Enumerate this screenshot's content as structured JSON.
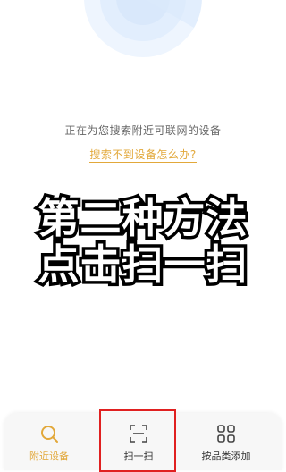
{
  "search": {
    "status_text": "正在为您搜索附近可联网的设备",
    "help_link": "搜索不到设备怎么办?"
  },
  "overlay": {
    "line1": "第二种方法",
    "line2": "点击扫一扫"
  },
  "tabs": [
    {
      "label": "附近设备",
      "icon": "search-icon",
      "active": true
    },
    {
      "label": "扫一扫",
      "icon": "scan-icon",
      "active": false
    },
    {
      "label": "按品类添加",
      "icon": "grid-icon",
      "active": false
    }
  ],
  "colors": {
    "accent": "#e2a83a",
    "radar": "#d9e8fb",
    "highlight_border": "#e02020"
  }
}
